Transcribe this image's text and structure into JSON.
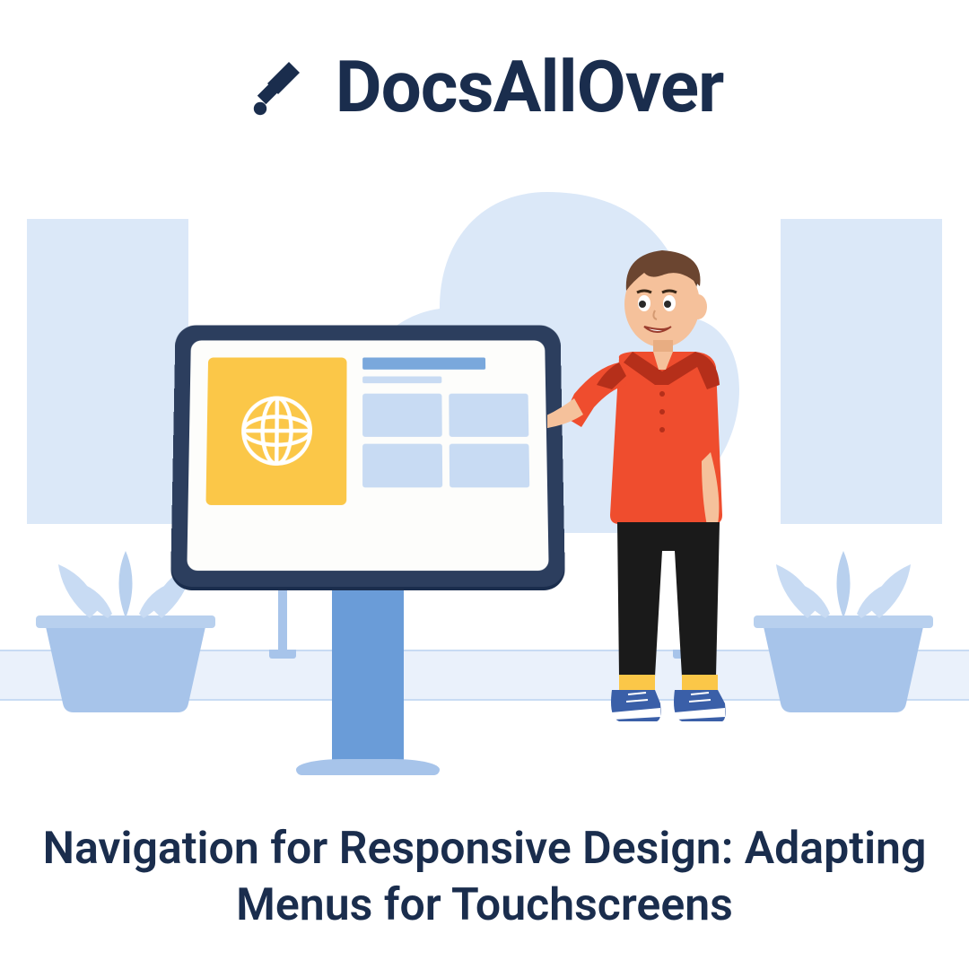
{
  "brand": {
    "name": "DocsAllOver",
    "logo_icon": "docsallover-logo"
  },
  "headline": "Navigation for Responsive Design: Adapting Menus for Touchscreens",
  "illustration": {
    "kiosk_tile_icon": "globe-icon",
    "colors": {
      "brand_dark": "#1a2d4d",
      "bg_light": "#dbe8f8",
      "accent_yellow": "#fbc748",
      "accent_blue": "#6a9cd8",
      "person_shirt": "#ef4d2e"
    }
  }
}
